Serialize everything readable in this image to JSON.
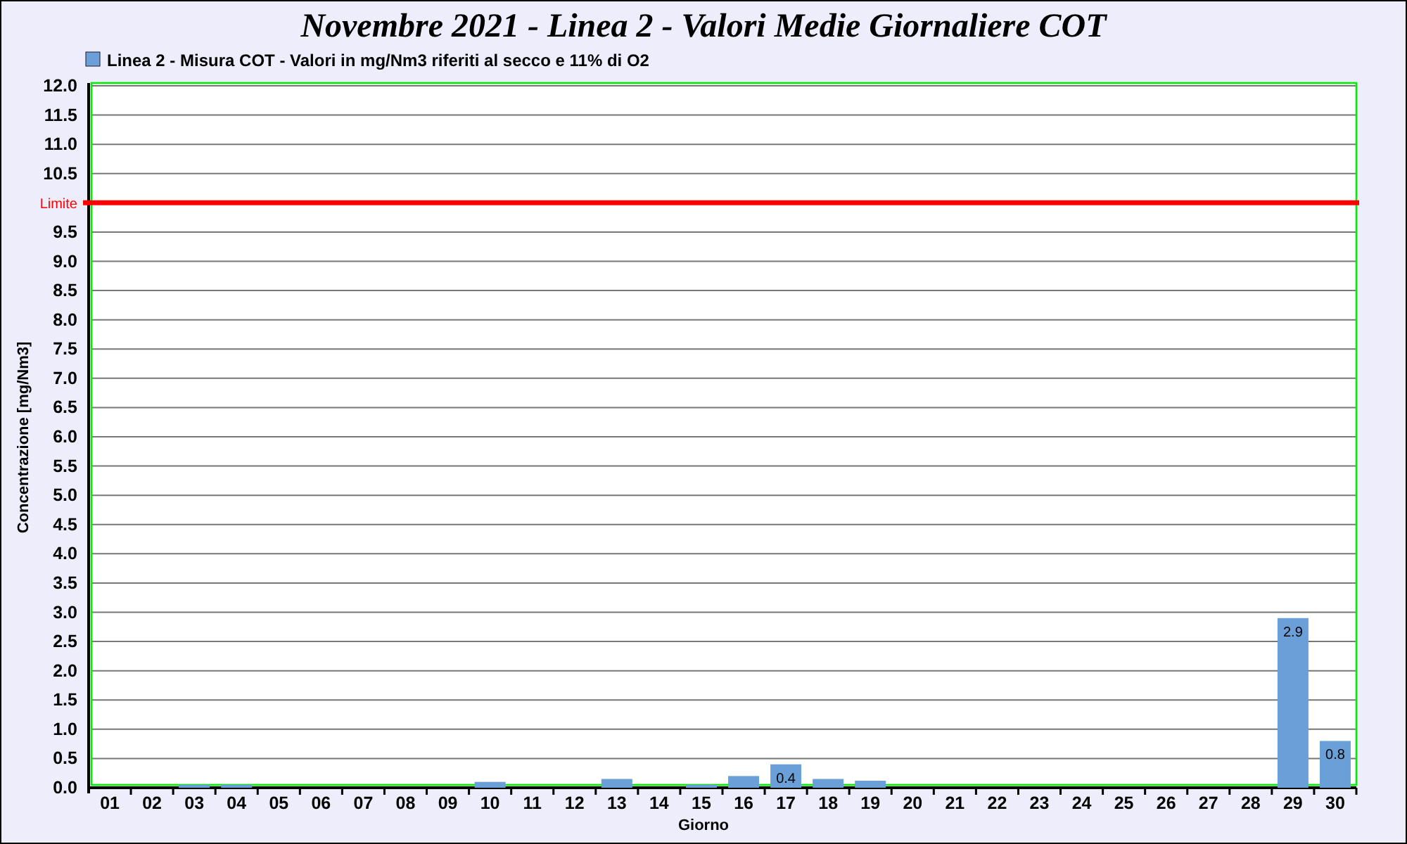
{
  "chart": {
    "title": "Novembre 2021 - Linea 2 - Valori Medie Giornaliere COT",
    "chart_data": {
      "type": "bar",
      "xlabel": "Giorno",
      "ylabel": "Concentrazione [mg/Nm3]",
      "categories": [
        "01",
        "02",
        "03",
        "04",
        "05",
        "06",
        "07",
        "08",
        "09",
        "10",
        "11",
        "12",
        "13",
        "14",
        "15",
        "16",
        "17",
        "18",
        "19",
        "20",
        "21",
        "22",
        "23",
        "24",
        "25",
        "26",
        "27",
        "28",
        "29",
        "30"
      ],
      "series": [
        {
          "name": "Linea 2 - Misura COT - Valori in mg/Nm3 riferiti al secco e 11% di O2",
          "color": "#6a9fd8",
          "values": [
            0,
            0,
            0.05,
            0.05,
            0,
            0,
            0,
            0,
            0,
            0.1,
            0,
            0,
            0.15,
            0,
            0.05,
            0.2,
            0.4,
            0.15,
            0.12,
            0,
            0,
            0,
            0,
            0,
            0,
            0,
            0,
            0,
            2.9,
            0.8
          ]
        }
      ],
      "value_labels": [
        null,
        null,
        null,
        null,
        null,
        null,
        null,
        null,
        null,
        null,
        null,
        null,
        null,
        null,
        null,
        null,
        "0.4",
        null,
        null,
        null,
        null,
        null,
        null,
        null,
        null,
        null,
        null,
        null,
        "2.9",
        "0.8"
      ],
      "ylim": [
        0,
        12
      ],
      "yticks": [
        {
          "value": 0,
          "label": "0.0"
        },
        0.5,
        {
          "value": 1,
          "label": "1.0"
        },
        1.5,
        {
          "value": 2,
          "label": "2.0"
        },
        2.5,
        {
          "value": 3,
          "label": "3.0"
        },
        3.5,
        {
          "value": 4,
          "label": "4.0"
        },
        4.5,
        {
          "value": 5,
          "label": "5.0"
        },
        5.5,
        {
          "value": 6,
          "label": "6.0"
        },
        6.5,
        {
          "value": 7,
          "label": "7.0"
        },
        7.5,
        {
          "value": 8,
          "label": "8.0"
        },
        8.5,
        {
          "value": 9,
          "label": "9.0"
        },
        9.5,
        10.5,
        {
          "value": 11,
          "label": "11.0"
        },
        11.5,
        {
          "value": 12,
          "label": "12.0"
        }
      ],
      "grid": true,
      "ref_lines": [
        {
          "axis": "y",
          "value": 10,
          "label": "Limite",
          "color": "#ff0000"
        }
      ]
    }
  }
}
